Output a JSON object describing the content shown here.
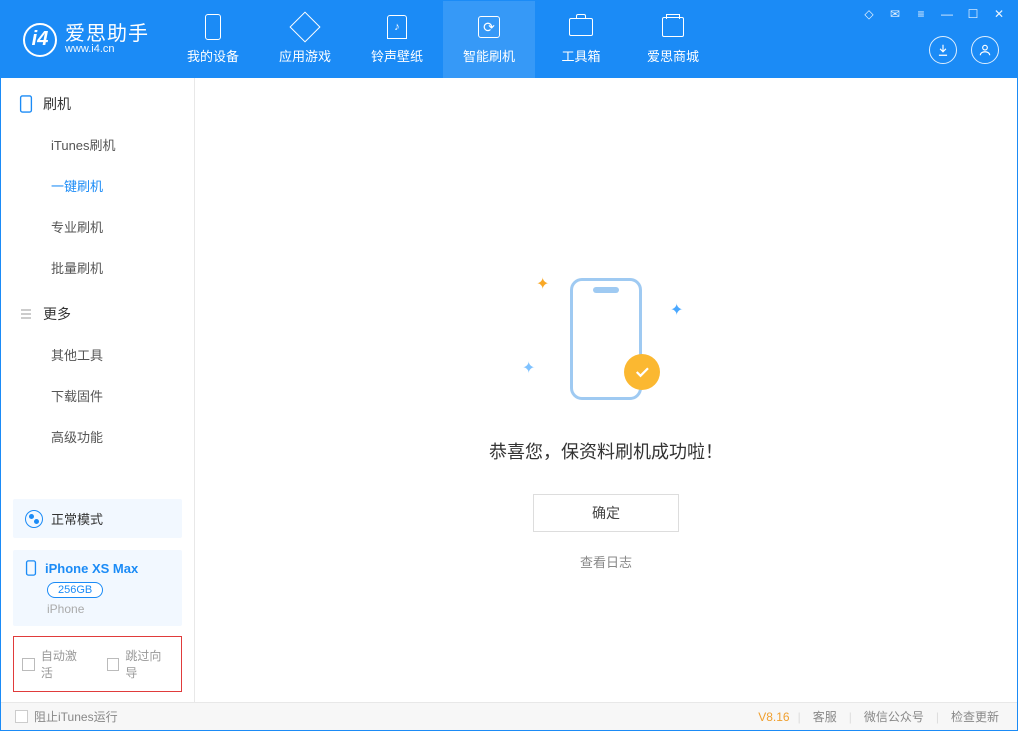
{
  "logo": {
    "cn": "爱思助手",
    "url": "www.i4.cn"
  },
  "tabs": [
    {
      "label": "我的设备"
    },
    {
      "label": "应用游戏"
    },
    {
      "label": "铃声壁纸"
    },
    {
      "label": "智能刷机"
    },
    {
      "label": "工具箱"
    },
    {
      "label": "爱思商城"
    }
  ],
  "sidebar": {
    "section1": {
      "title": "刷机",
      "items": [
        "iTunes刷机",
        "一键刷机",
        "专业刷机",
        "批量刷机"
      ]
    },
    "section2": {
      "title": "更多",
      "items": [
        "其他工具",
        "下载固件",
        "高级功能"
      ]
    }
  },
  "mode": {
    "label": "正常模式"
  },
  "device": {
    "name": "iPhone XS Max",
    "capacity": "256GB",
    "type": "iPhone"
  },
  "options": {
    "auto_activate": "自动激活",
    "skip_guide": "跳过向导"
  },
  "main": {
    "success_text": "恭喜您，保资料刷机成功啦！",
    "ok_button": "确定",
    "log_link": "查看日志"
  },
  "footer": {
    "block_itunes": "阻止iTunes运行",
    "version": "V8.16",
    "links": [
      "客服",
      "微信公众号",
      "检查更新"
    ]
  }
}
